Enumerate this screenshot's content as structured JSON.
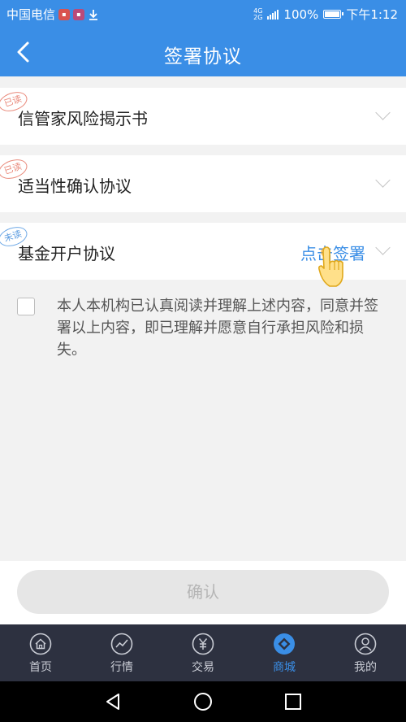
{
  "status_bar": {
    "carrier": "中国电信",
    "network": [
      "4G",
      "2G"
    ],
    "battery": "100%",
    "time": "下午1:12"
  },
  "nav": {
    "title": "签署协议"
  },
  "agreements": [
    {
      "label": "信管家风险揭示书",
      "stamp": "已读",
      "action": ""
    },
    {
      "label": "适当性确认协议",
      "stamp": "已读",
      "action": ""
    },
    {
      "label": "基金开户协议",
      "stamp": "未读",
      "action": "点击签署"
    }
  ],
  "consent": {
    "text": "本人本机构已认真阅读并理解上述内容，同意并签署以上内容，即已理解并愿意自行承担风险和损失。",
    "checked": false
  },
  "confirm": {
    "label": "确认"
  },
  "tabs": [
    {
      "label": "首页",
      "icon": "home-icon",
      "active": false
    },
    {
      "label": "行情",
      "icon": "chart-icon",
      "active": false
    },
    {
      "label": "交易",
      "icon": "yen-icon",
      "active": false
    },
    {
      "label": "商城",
      "icon": "diamond-icon",
      "active": true
    },
    {
      "label": "我的",
      "icon": "user-icon",
      "active": false
    }
  ],
  "colors": {
    "accent": "#3a8ee6",
    "tabbar": "#2d3140",
    "read_stamp": "#e9897a",
    "unread_stamp": "#5a9be0"
  }
}
